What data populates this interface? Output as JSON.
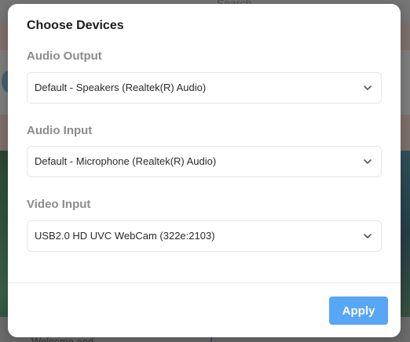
{
  "background": {
    "search_text": "Search",
    "bottom_text": "Welcome and"
  },
  "dialog": {
    "title": "Choose Devices",
    "fields": [
      {
        "label": "Audio Output",
        "value": "Default - Speakers (Realtek(R) Audio)",
        "icon": "chevron-down-icon"
      },
      {
        "label": "Audio Input",
        "value": "Default - Microphone (Realtek(R) Audio)",
        "icon": "chevron-down-icon"
      },
      {
        "label": "Video Input",
        "value": "USB2.0 HD UVC WebCam (322e:2103)",
        "icon": "chevron-down-icon"
      }
    ],
    "apply_label": "Apply"
  },
  "colors": {
    "accent": "#58a6f6",
    "label": "#8c8c8c",
    "title": "#1c1c1c"
  }
}
